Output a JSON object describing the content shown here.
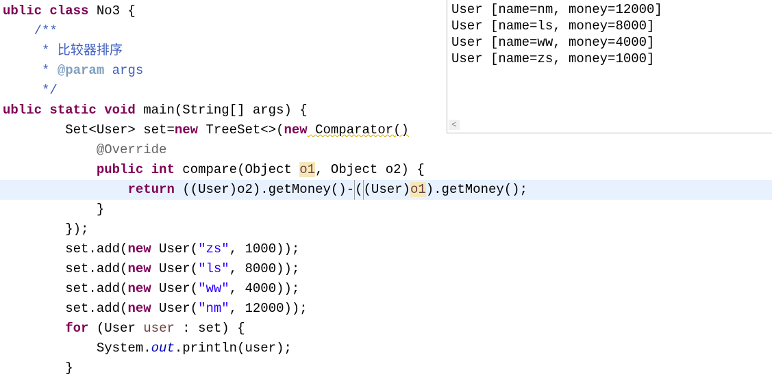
{
  "code": {
    "l1_kw1": "ublic class",
    "l1_cls": " No3 {",
    "l2_doc": "    /**",
    "l3_doc_pre": "     * ",
    "l3_doc_txt": "比较器排序",
    "l4_doc_pre": "     * ",
    "l4_tag": "@param",
    "l4_arg": " args",
    "l5_doc": "     */",
    "l6_pre": "ublic static void",
    "l6_mid": " main(String[] args) {",
    "l7_a": "        Set<User> set=",
    "l7_new1": "new",
    "l7_b": " TreeSet<>(",
    "l7_new2": "new",
    "l7_c": " Comparator()",
    "l8_ann": "            @Override",
    "l9_a": "            ",
    "l9_kw": "public int",
    "l9_b": " compare(Object ",
    "l9_o1": "o1",
    "l9_c": ", Object o2) {",
    "l10_a": "                ",
    "l10_kw": "return",
    "l10_b": " ((User)o2).getMoney()-",
    "l10_paren": "(",
    "l10_c": "(User)",
    "l10_o1": "o1",
    "l10_d": ").getMoney();",
    "l11": "            }",
    "l12": "        });",
    "l13_a": "        set.add(",
    "l13_new": "new",
    "l13_b": " User(",
    "l13_s": "\"zs\"",
    "l13_c": ", 1000));",
    "l14_a": "        set.add(",
    "l14_new": "new",
    "l14_b": " User(",
    "l14_s": "\"ls\"",
    "l14_c": ", 8000));",
    "l15_a": "        set.add(",
    "l15_new": "new",
    "l15_b": " User(",
    "l15_s": "\"ww\"",
    "l15_c": ", 4000));",
    "l16_a": "        set.add(",
    "l16_new": "new",
    "l16_b": " User(",
    "l16_s": "\"nm\"",
    "l16_c": ", 12000));",
    "l17_a": "        ",
    "l17_kw": "for",
    "l17_b": " (User ",
    "l17_var": "user",
    "l17_c": " : set) {",
    "l18_a": "            System.",
    "l18_out": "out",
    "l18_b": ".println(user);",
    "l19": "        }"
  },
  "output": {
    "l1": "User [name=nm, money=12000]",
    "l2": "User [name=ls, money=8000]",
    "l3": "User [name=ww, money=4000]",
    "l4": "User [name=zs, money=1000]"
  },
  "terminator": "<"
}
